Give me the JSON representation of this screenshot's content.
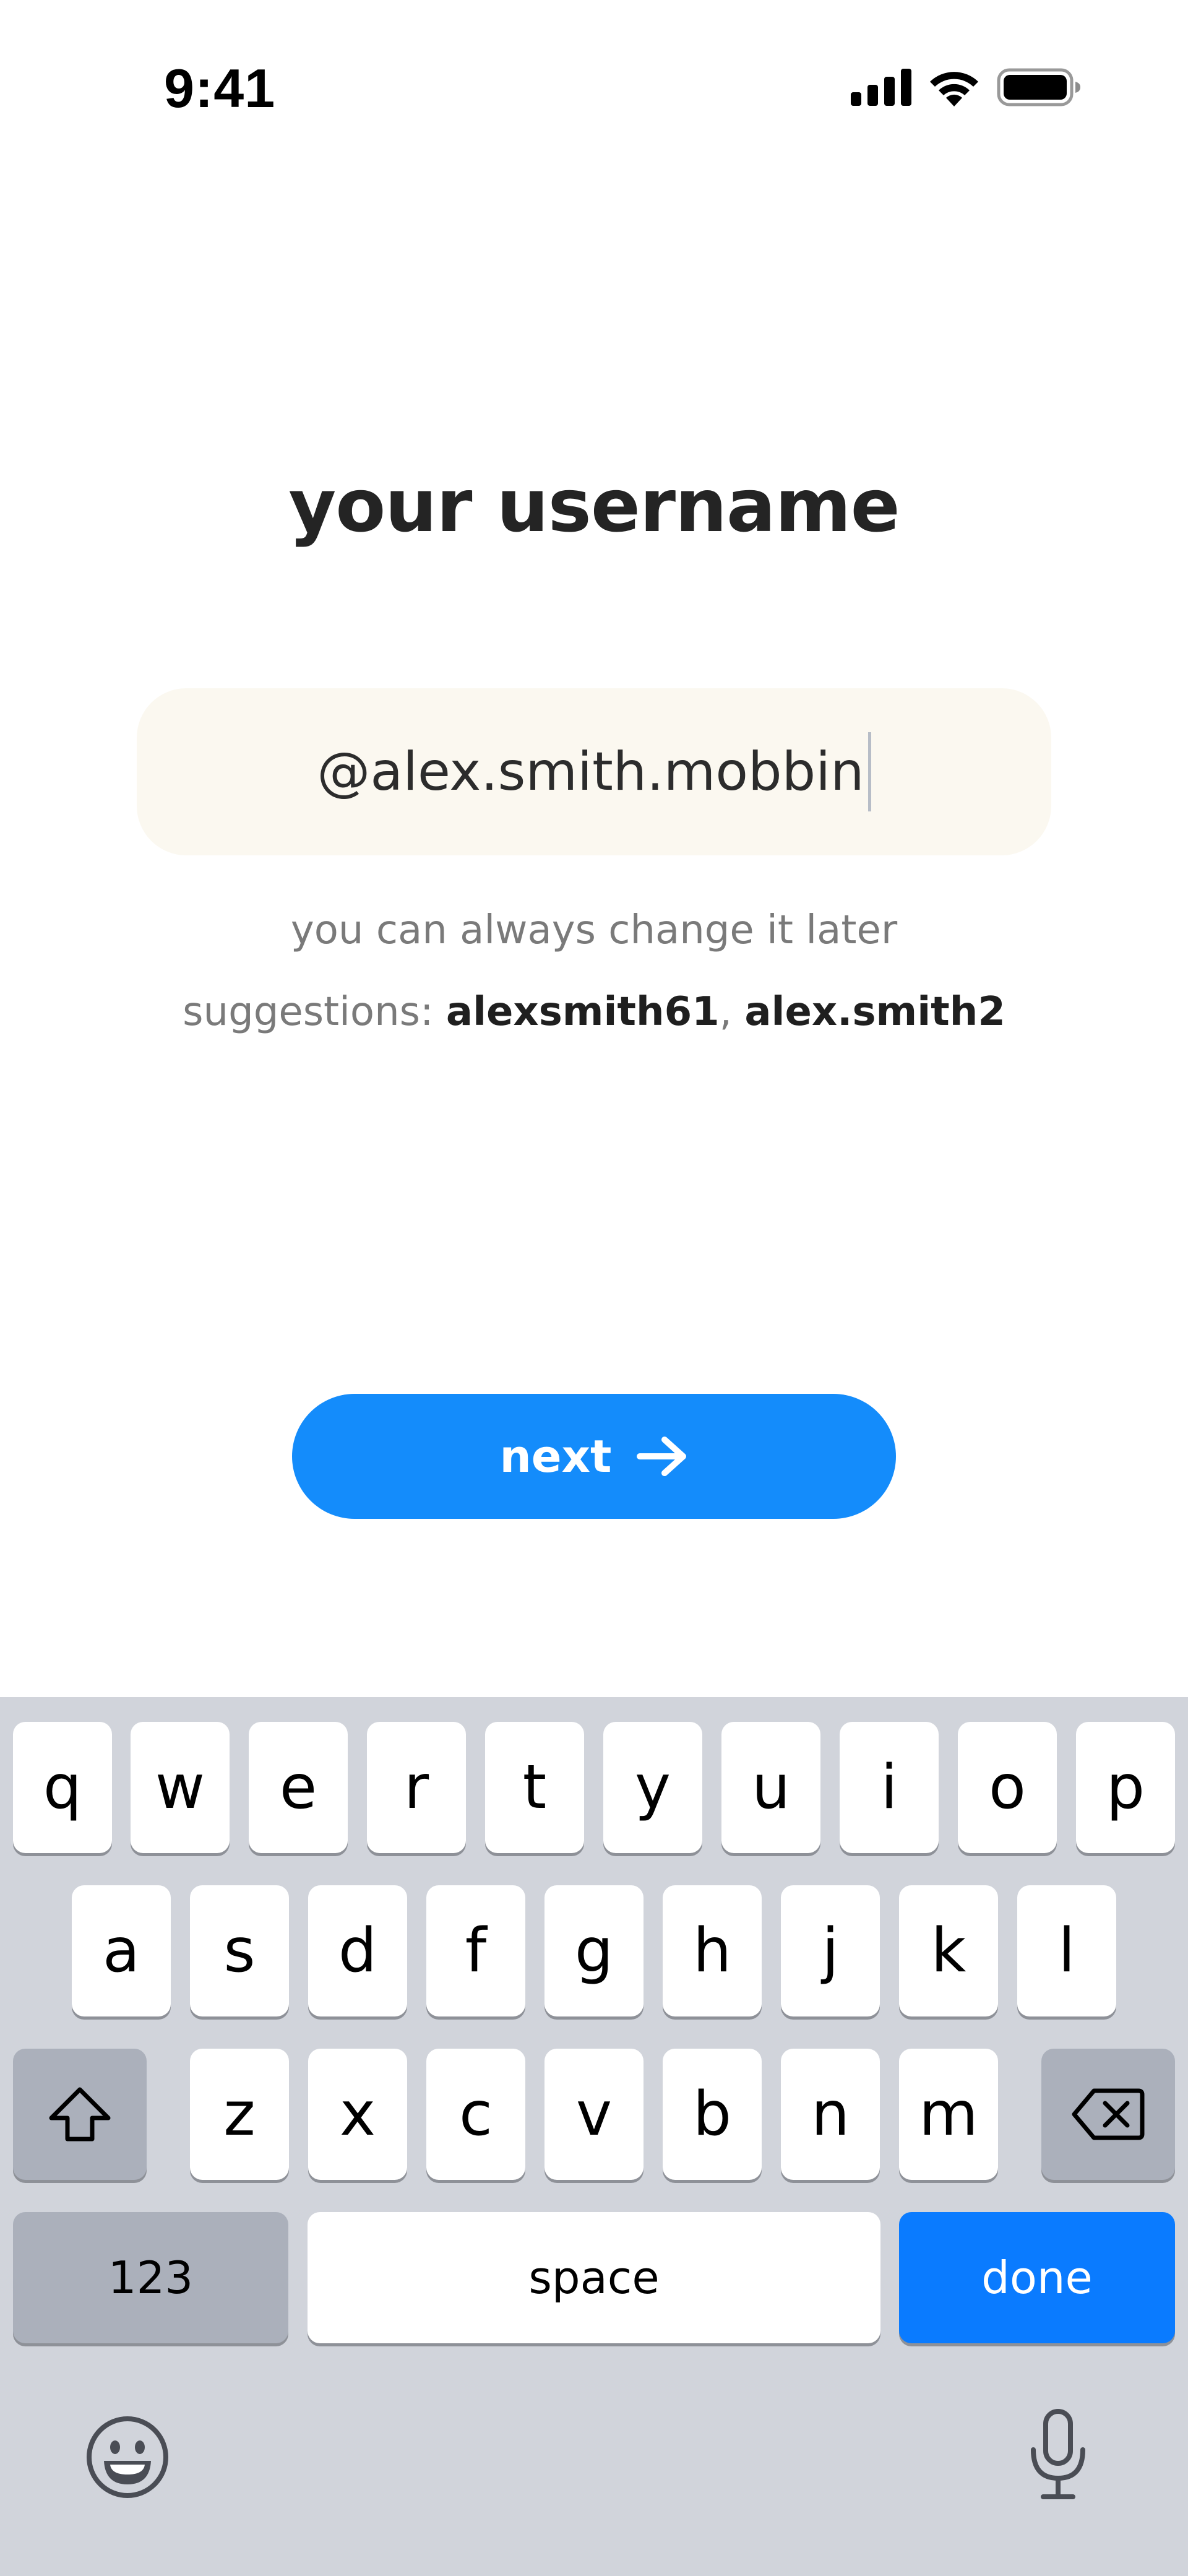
{
  "status_bar": {
    "time": "9:41",
    "icons": [
      "cellular-signal-icon",
      "wifi-icon",
      "battery-icon"
    ]
  },
  "title": "your username",
  "username_field": {
    "value": "@alex.smith.mobbin",
    "background": "#fbf8f0"
  },
  "hint": "you can always change it later",
  "suggestions": {
    "prefix": "suggestions:",
    "items": [
      "alexsmith61",
      "alex.smith2"
    ],
    "separator": ","
  },
  "next_button": {
    "label": "next",
    "icon": "arrow-right-icon",
    "color": "#148cfb"
  },
  "keyboard": {
    "row1": [
      "q",
      "w",
      "e",
      "r",
      "t",
      "y",
      "u",
      "i",
      "o",
      "p"
    ],
    "row2": [
      "a",
      "s",
      "d",
      "f",
      "g",
      "h",
      "j",
      "k",
      "l"
    ],
    "row3": [
      "z",
      "x",
      "c",
      "v",
      "b",
      "n",
      "m"
    ],
    "shift_icon": "shift-icon",
    "delete_icon": "delete-icon",
    "numbers_label": "123",
    "space_label": "space",
    "done_label": "done",
    "emoji_icon": "emoji-icon",
    "mic_icon": "microphone-icon",
    "background": "#d1d4db",
    "done_color": "#0a7bff"
  }
}
